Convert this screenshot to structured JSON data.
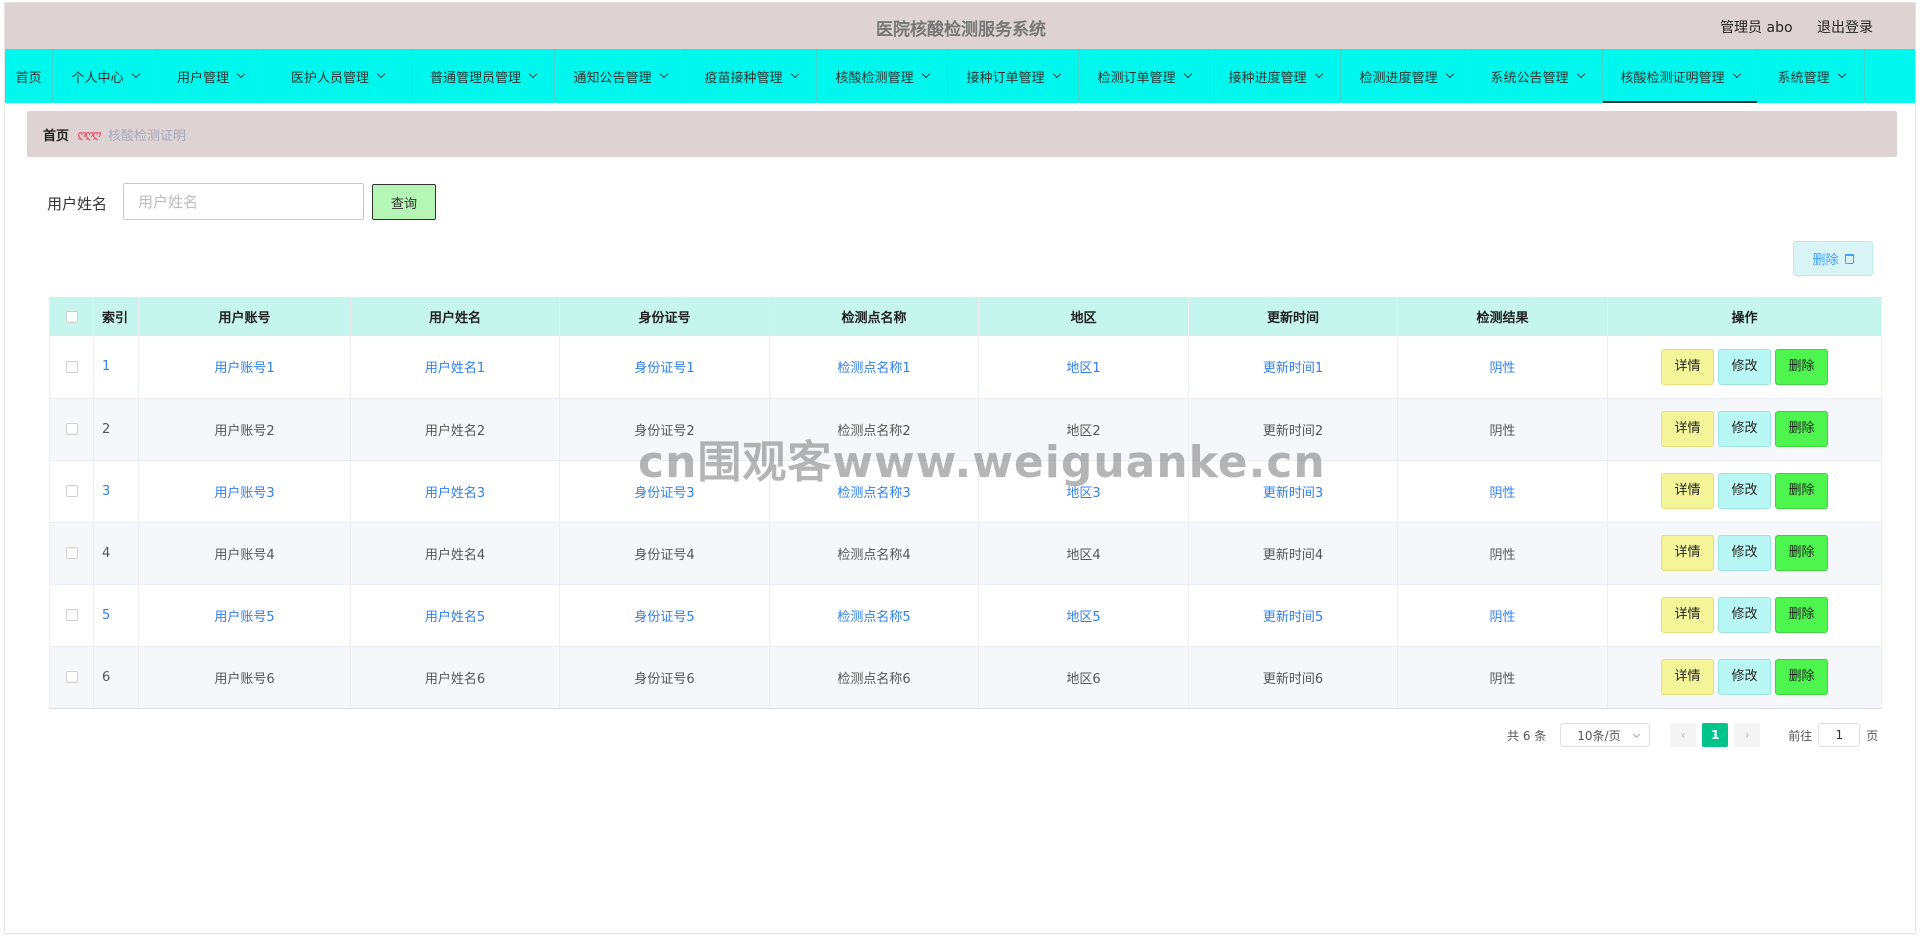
{
  "header": {
    "title": "医院核酸检测服务系统",
    "user_label": "管理员 abo",
    "logout_label": "退出登录"
  },
  "nav": {
    "items": [
      {
        "label": "首页",
        "has_dropdown": false
      },
      {
        "label": "个人中心",
        "has_dropdown": true
      },
      {
        "label": "用户管理",
        "has_dropdown": true
      },
      {
        "label": "医护人员管理",
        "has_dropdown": true
      },
      {
        "label": "普通管理员管理",
        "has_dropdown": true
      },
      {
        "label": "通知公告管理",
        "has_dropdown": true
      },
      {
        "label": "疫苗接种管理",
        "has_dropdown": true
      },
      {
        "label": "核酸检测管理",
        "has_dropdown": true
      },
      {
        "label": "接种订单管理",
        "has_dropdown": true
      },
      {
        "label": "检测订单管理",
        "has_dropdown": true
      },
      {
        "label": "接种进度管理",
        "has_dropdown": true
      },
      {
        "label": "检测进度管理",
        "has_dropdown": true
      },
      {
        "label": "系统公告管理",
        "has_dropdown": true
      },
      {
        "label": "核酸检测证明管理",
        "has_dropdown": true,
        "active": true
      },
      {
        "label": "系统管理",
        "has_dropdown": true
      }
    ]
  },
  "breadcrumb": {
    "home": "首页",
    "separator": "ღღღ",
    "current": "核酸检测证明"
  },
  "search": {
    "label": "用户姓名",
    "placeholder": "用户姓名",
    "button_label": "查询"
  },
  "toolbar": {
    "delete_label": "删除"
  },
  "table": {
    "columns": [
      "索引",
      "用户账号",
      "用户姓名",
      "身份证号",
      "检测点名称",
      "地区",
      "更新时间",
      "检测结果",
      "操作"
    ],
    "rows": [
      {
        "index": "1",
        "account": "用户账号1",
        "name": "用户姓名1",
        "id_card": "身份证号1",
        "site": "检测点名称1",
        "region": "地区1",
        "updated": "更新时间1",
        "result": "阴性"
      },
      {
        "index": "2",
        "account": "用户账号2",
        "name": "用户姓名2",
        "id_card": "身份证号2",
        "site": "检测点名称2",
        "region": "地区2",
        "updated": "更新时间2",
        "result": "阴性"
      },
      {
        "index": "3",
        "account": "用户账号3",
        "name": "用户姓名3",
        "id_card": "身份证号3",
        "site": "检测点名称3",
        "region": "地区3",
        "updated": "更新时间3",
        "result": "阴性"
      },
      {
        "index": "4",
        "account": "用户账号4",
        "name": "用户姓名4",
        "id_card": "身份证号4",
        "site": "检测点名称4",
        "region": "地区4",
        "updated": "更新时间4",
        "result": "阴性"
      },
      {
        "index": "5",
        "account": "用户账号5",
        "name": "用户姓名5",
        "id_card": "身份证号5",
        "site": "检测点名称5",
        "region": "地区5",
        "updated": "更新时间5",
        "result": "阴性"
      },
      {
        "index": "6",
        "account": "用户账号6",
        "name": "用户姓名6",
        "id_card": "身份证号6",
        "site": "检测点名称6",
        "region": "地区6",
        "updated": "更新时间6",
        "result": "阴性"
      }
    ],
    "actions": {
      "detail": "详情",
      "edit": "修改",
      "delete": "删除"
    }
  },
  "pagination": {
    "total_text": "共 6 条",
    "page_size": "10条/页",
    "prev": "‹",
    "current_page": "1",
    "next": "›",
    "goto_label": "前往",
    "goto_value": "1",
    "page_suffix": "页"
  },
  "watermark": "cn围观客www.weiguanke.cn",
  "colors": {
    "header_bg": "#ddd3d3",
    "nav_bg": "#00f7ee",
    "table_header_bg": "#c6f5ee",
    "link_blue": "#2f80ed",
    "detail_btn": "#f4f499",
    "edit_btn": "#b8f7f4",
    "delete_btn": "#4ef54e",
    "page_active": "#00c48c"
  }
}
